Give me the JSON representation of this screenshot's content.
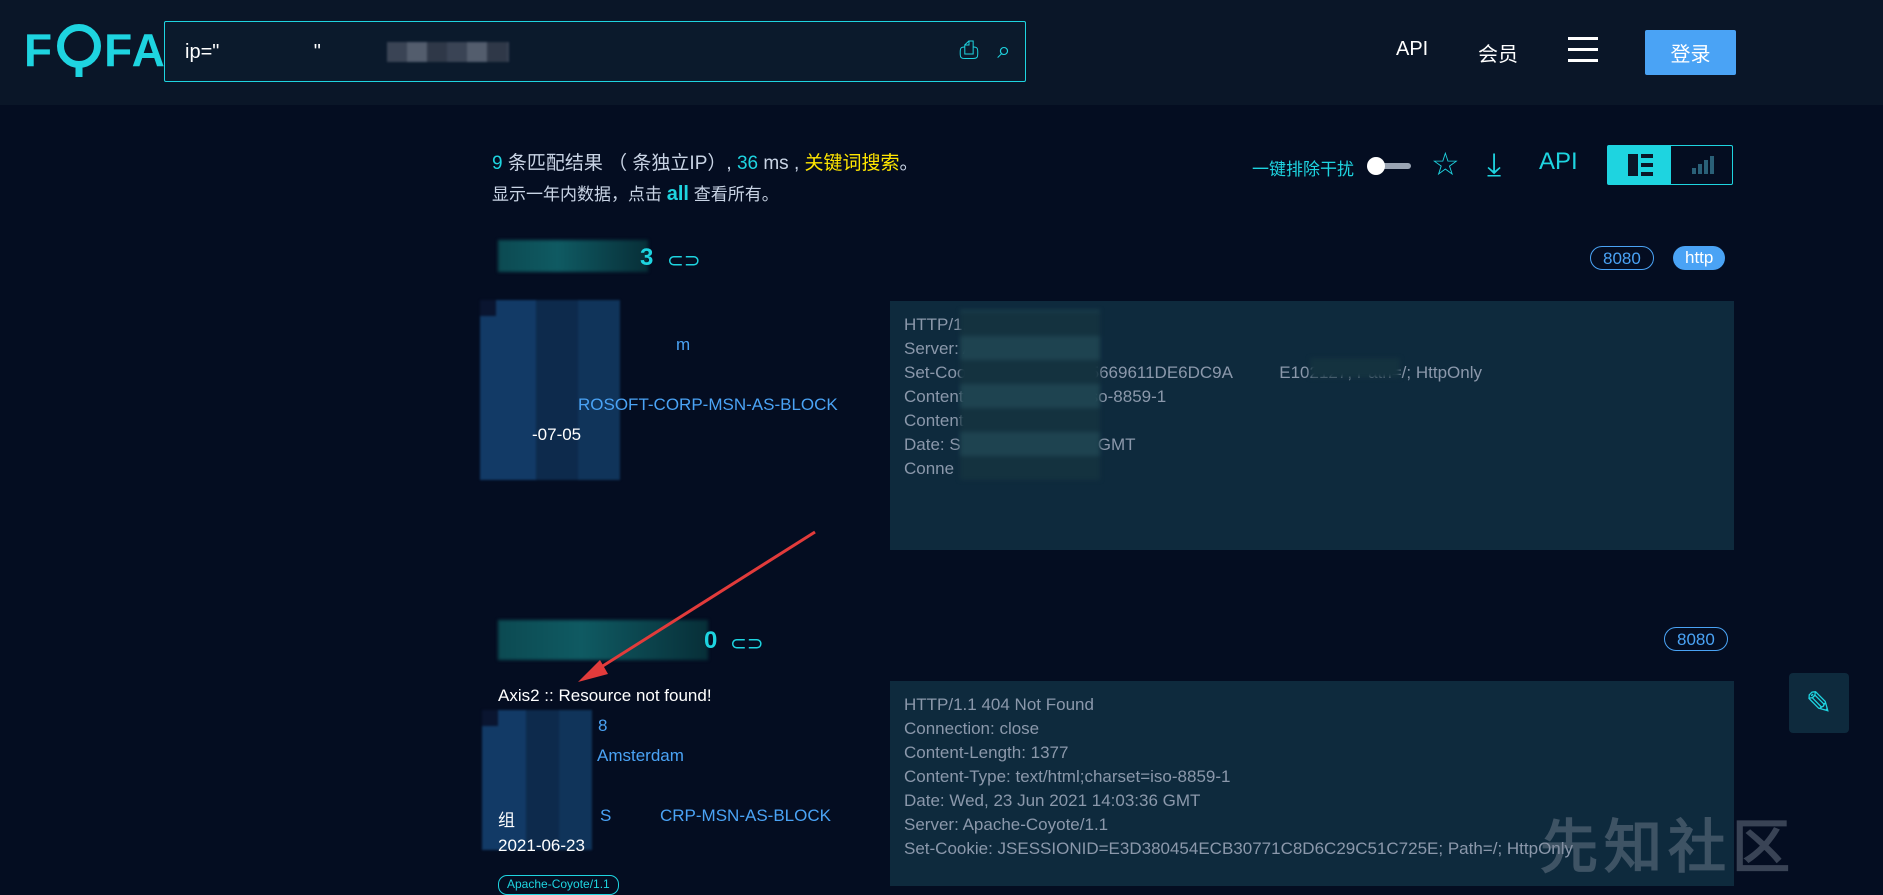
{
  "header": {
    "logo": "FOFA",
    "search_value": "ip=\"                 \"",
    "nav": {
      "api": "API",
      "member": "会员"
    },
    "login": "登录"
  },
  "stats": {
    "count": "9",
    "count_suffix": " 条匹配结果 （ 条独立IP）,",
    "time": "36",
    "time_unit": " ms ,",
    "keyword_search": "关键词搜索",
    "period": "。",
    "line2_prefix": "显示一年内数据，点击 ",
    "all": "all",
    "line2_suffix": " 查看所有。"
  },
  "toolbar": {
    "exclude_label": "一键排除干扰",
    "exclude_enabled": false,
    "api": "API"
  },
  "results": [
    {
      "host_suffix": "3",
      "ports": [
        "8080",
        "http"
      ],
      "geo_suffix": "m",
      "org_suffix": "ROSOFT-CORP-MSN-AS-BLOCK",
      "date_suffix": "-07-05",
      "banner": "HTTP/1.1      No\nServer: A         e\nSet-Cook           =F6FFD5669611DE6DC9A          E102127; Path=/; HttpOnly\nContent            charset=iso-8859-1\nContent\nDate: S              20:13:44 GMT\nConne        clos"
    },
    {
      "host_suffix": "0",
      "ports": [
        "8080"
      ],
      "title": "Axis2 :: Resource not found!",
      "ip_prefix": "40",
      "ip_suffix": "8",
      "city": "Amsterdam",
      "org_prefix": "组",
      "org_mid": "S",
      "org_suffix": "CRP-MSN-AS-BLOCK",
      "date": "2021-06-23",
      "server_tag": "Apache-Coyote/1.1",
      "banner": "HTTP/1.1 404 Not Found\nConnection: close\nContent-Length: 1377\nContent-Type: text/html;charset=iso-8859-1\nDate: Wed, 23 Jun 2021 14:03:36 GMT\nServer: Apache-Coyote/1.1\nSet-Cookie: JSESSIONID=E3D380454ECB30771C8D6C29C51C725E; Path=/; HttpOnly"
    }
  ],
  "watermark": "先知社区",
  "colors": {
    "accent": "#1ed4e0",
    "link": "#4aa3f5",
    "keyword": "#ffe600",
    "bg": "#040d21"
  }
}
